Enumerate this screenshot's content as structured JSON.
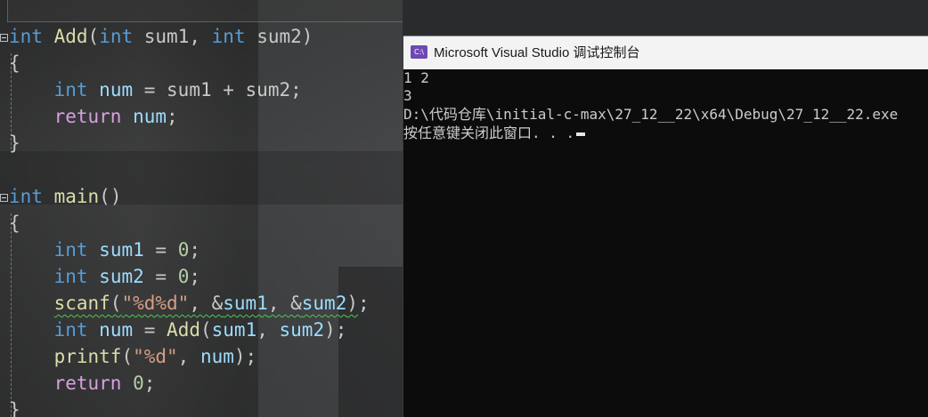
{
  "editor": {
    "lines": [
      {
        "id": "l1",
        "tokens": [
          [
            "kw",
            "int"
          ],
          [
            "plain",
            " "
          ],
          [
            "fn",
            "Add"
          ],
          [
            "plain",
            "("
          ],
          [
            "kw",
            "int"
          ],
          [
            "plain",
            " sum1, "
          ],
          [
            "kw",
            "int"
          ],
          [
            "plain",
            " sum2)"
          ]
        ]
      },
      {
        "id": "l2",
        "tokens": [
          [
            "plain",
            "{"
          ]
        ]
      },
      {
        "id": "l3",
        "tokens": [
          [
            "plain",
            "    "
          ],
          [
            "kw",
            "int"
          ],
          [
            "plain",
            " "
          ],
          [
            "var",
            "num"
          ],
          [
            "plain",
            " = sum1 + sum2;"
          ]
        ]
      },
      {
        "id": "l4",
        "tokens": [
          [
            "plain",
            "    "
          ],
          [
            "kw-ret",
            "return"
          ],
          [
            "plain",
            " "
          ],
          [
            "var",
            "num"
          ],
          [
            "plain",
            ";"
          ]
        ]
      },
      {
        "id": "l5",
        "tokens": [
          [
            "plain",
            "}"
          ]
        ]
      },
      {
        "id": "l6",
        "tokens": []
      },
      {
        "id": "l7",
        "tokens": [
          [
            "kw",
            "int"
          ],
          [
            "plain",
            " "
          ],
          [
            "fn",
            "main"
          ],
          [
            "plain",
            "()"
          ]
        ]
      },
      {
        "id": "l8",
        "tokens": [
          [
            "plain",
            "{"
          ]
        ]
      },
      {
        "id": "l9",
        "tokens": [
          [
            "plain",
            "    "
          ],
          [
            "kw",
            "int"
          ],
          [
            "plain",
            " "
          ],
          [
            "var",
            "sum1"
          ],
          [
            "plain",
            " = "
          ],
          [
            "num",
            "0"
          ],
          [
            "plain",
            ";"
          ]
        ]
      },
      {
        "id": "l10",
        "tokens": [
          [
            "plain",
            "    "
          ],
          [
            "kw",
            "int"
          ],
          [
            "plain",
            " "
          ],
          [
            "var",
            "sum2"
          ],
          [
            "plain",
            " = "
          ],
          [
            "num",
            "0"
          ],
          [
            "plain",
            ";"
          ]
        ]
      },
      {
        "id": "l11",
        "tokens": [
          [
            "plain",
            "    "
          ],
          [
            "fn squiggle",
            "scanf"
          ],
          [
            "plain squiggle",
            "("
          ],
          [
            "str squiggle",
            "\"%d%d\""
          ],
          [
            "plain squiggle",
            ", &"
          ],
          [
            "var squiggle",
            "sum1"
          ],
          [
            "plain squiggle",
            ", &"
          ],
          [
            "var squiggle",
            "sum2"
          ],
          [
            "plain squiggle",
            ")"
          ],
          [
            "plain",
            ";"
          ]
        ]
      },
      {
        "id": "l12",
        "tokens": [
          [
            "plain",
            "    "
          ],
          [
            "kw",
            "int"
          ],
          [
            "plain",
            " "
          ],
          [
            "var",
            "num"
          ],
          [
            "plain",
            " = "
          ],
          [
            "fn",
            "Add"
          ],
          [
            "plain",
            "("
          ],
          [
            "var",
            "sum1"
          ],
          [
            "plain",
            ", "
          ],
          [
            "var",
            "sum2"
          ],
          [
            "plain",
            ");"
          ]
        ]
      },
      {
        "id": "l13",
        "tokens": [
          [
            "plain",
            "    "
          ],
          [
            "fn",
            "printf"
          ],
          [
            "plain",
            "("
          ],
          [
            "str",
            "\"%d\""
          ],
          [
            "plain",
            ", "
          ],
          [
            "var",
            "num"
          ],
          [
            "plain",
            ");"
          ]
        ]
      },
      {
        "id": "l14",
        "tokens": [
          [
            "plain",
            "    "
          ],
          [
            "kw-ret",
            "return"
          ],
          [
            "plain",
            " "
          ],
          [
            "num",
            "0"
          ],
          [
            "plain",
            ";"
          ]
        ]
      },
      {
        "id": "l15",
        "tokens": [
          [
            "plain",
            "}"
          ]
        ]
      }
    ]
  },
  "console": {
    "title": "Microsoft Visual Studio 调试控制台",
    "icon_label": "C:\\",
    "output": [
      "1 2",
      "3",
      "D:\\代码仓库\\initial-c-max\\27_12__22\\x64\\Debug\\27_12__22.exe",
      "按任意键关闭此窗口. . ."
    ],
    "accent": "#6c4ab2"
  }
}
